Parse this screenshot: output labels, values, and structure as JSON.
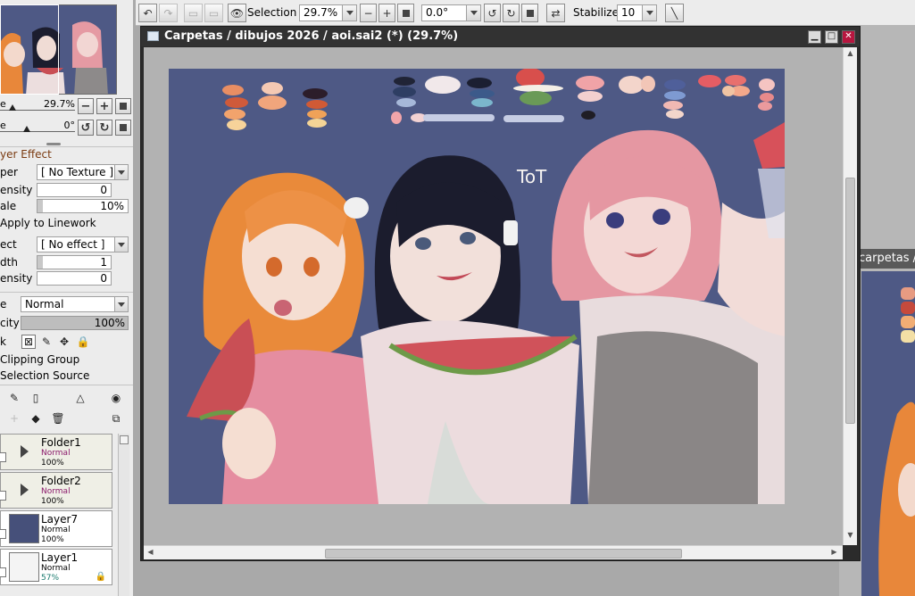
{
  "toolbar": {
    "selection_label": "Selection",
    "zoom_value": "29.7%",
    "rotation_value": "0.0°",
    "stabilizer_label": "Stabilizer",
    "stabilizer_value": "10"
  },
  "navigator": {
    "zoom_label": "e",
    "zoom_value": "29.7%",
    "angle_label": "e",
    "angle_value": "0°"
  },
  "effect": {
    "header": "yer Effect",
    "paper_label": "per",
    "paper_value": "[ No Texture ]",
    "paper_intensity_label": "ensity",
    "paper_intensity_value": "0",
    "scale_label": "ale",
    "scale_value": "10%",
    "apply_linework_label": "Apply to Linework",
    "effect_label": "ect",
    "effect_value": "[ No effect ]",
    "width_label": "dth",
    "width_value": "1",
    "effect_intensity_label": "ensity",
    "effect_intensity_value": "0"
  },
  "layer_props": {
    "mode_label": "e",
    "mode_value": "Normal",
    "opacity_label": "city",
    "opacity_value": "100%",
    "lock_label": "k",
    "clipping_label": "Clipping Group",
    "selection_source_label": "Selection Source"
  },
  "layers": [
    {
      "name": "Folder1",
      "mode": "Normal",
      "opacity": "100%",
      "type": "folder"
    },
    {
      "name": "Folder2",
      "mode": "Normal",
      "opacity": "100%",
      "type": "folder"
    },
    {
      "name": "Layer7",
      "mode": "Normal",
      "opacity": "100%",
      "type": "layer"
    },
    {
      "name": "Layer1",
      "mode": "Normal",
      "opacity": "57%",
      "type": "layer"
    }
  ],
  "window": {
    "title": "Carpetas / dibujos 2026 / aoi.sai2 (*) (29.7%)"
  },
  "window2": {
    "title": "carpetas /"
  },
  "artwork": {
    "doodle_text": "ToT"
  },
  "colors": {
    "canvas_bg": "#4e5985",
    "panel_bg": "#ececec",
    "title_bar": "#323232",
    "close_button": "#b7163f",
    "folder_mode": "#8b1a6b",
    "opacity_low": "#1a7a6e"
  }
}
